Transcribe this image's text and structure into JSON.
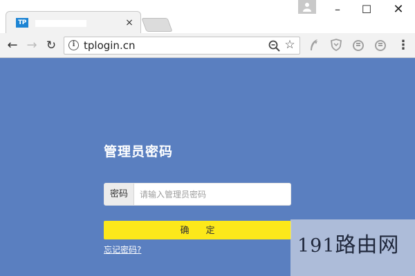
{
  "browser": {
    "tab": {
      "favicon_text": "TP",
      "close_glyph": "×"
    },
    "window_controls": {
      "minimize": "–",
      "maximize": "☐",
      "close": "✕"
    },
    "toolbar": {
      "back_glyph": "←",
      "forward_glyph": "→",
      "reload_glyph": "↻",
      "url": "tplogin.cn",
      "info_glyph": "i",
      "star_glyph": "☆",
      "menu_glyph": "⋮"
    },
    "extensions": [
      "feather-icon",
      "shield-icon",
      "circle-icon",
      "circle-icon"
    ]
  },
  "page": {
    "heading": "管理员密码",
    "password_label": "密码",
    "password_placeholder": "请输入管理员密码",
    "password_value": "",
    "confirm_label": "确定",
    "forgot_link": "忘记密码?"
  },
  "watermark": {
    "text_num": "191",
    "text_cn": "路由网"
  },
  "colors": {
    "page_bg": "#5a7fc0",
    "confirm_bg": "#fce81a",
    "favicon_bg": "#1c84d4"
  }
}
